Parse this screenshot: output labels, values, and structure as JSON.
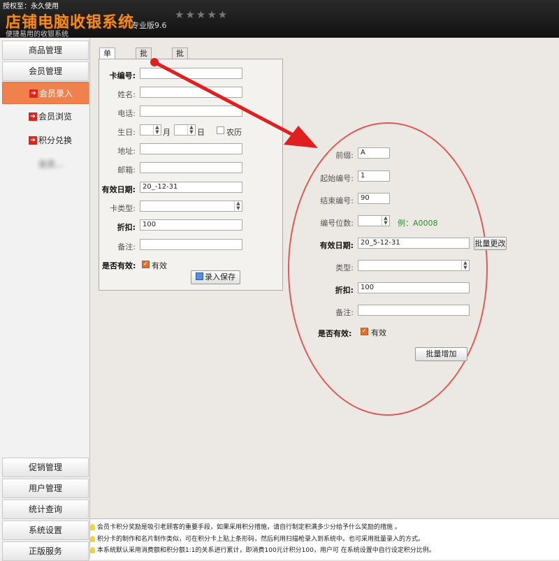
{
  "header": {
    "license": "授权至：永久使用",
    "app_title": "店铺电脑收银系统",
    "edition": "专业版9.6",
    "stars": "★★★★★",
    "slogan": "便捷易用的收银系统"
  },
  "sidebar": {
    "top": [
      "商品管理",
      "会员管理"
    ],
    "sub": [
      "会员录入",
      "会员浏览",
      "积分兑换",
      "会员..."
    ],
    "bottom": [
      "促销管理",
      "用户管理",
      "统计查询",
      "系统设置",
      "正版服务"
    ]
  },
  "tabs": [
    "单张录入",
    "批量录入",
    "批量导入"
  ],
  "single": {
    "card_no": "卡编号:",
    "name": "姓名:",
    "phone": "电话:",
    "birthday": "生日:",
    "month": "月",
    "day": "日",
    "lunar": "农历",
    "address": "地址:",
    "email": "邮箱:",
    "expiry": "有效日期:",
    "expiry_value": "20_-12-31",
    "card_type": "卡类型:",
    "discount": "折扣:",
    "discount_value": "100",
    "note": "备注:",
    "is_valid": "是否有效:",
    "valid": "有效",
    "save": "录入保存"
  },
  "batch": {
    "prefix": "前缀:",
    "prefix_value": "A",
    "start": "起始编号:",
    "start_value": "1",
    "end": "结束编号:",
    "end_value": "90",
    "digits": "编号位数:",
    "example": "例：A0008",
    "expiry": "有效日期:",
    "expiry_value": "20_5-12-31",
    "change": "批量更改",
    "type": "类型:",
    "discount": "折扣:",
    "discount_value": "100",
    "note": "备注:",
    "is_valid": "是否有效:",
    "valid": "有效",
    "add": "批量增加"
  },
  "tips": [
    "会员卡积分奖励是吸引老顾客的重要手段，如果采用积分措施，请自行制定积满多少分给予什么奖励的措施 。",
    "积分卡的制作和名片制作类似，可在积分卡上贴上条形码，然后利用扫描枪录入到系统中。也可采用批量录入的方式。",
    "本系统默认采用消费额和积分额1:1的关系进行累计，即消费100元计积分100，用户可 在系统设置中自行设定积分比例。"
  ],
  "colors": {
    "title_orange": "#f08a1a",
    "active_nav": "#f0814c",
    "annotation_red": "#e02020",
    "example_green": "#2a8a2a"
  }
}
